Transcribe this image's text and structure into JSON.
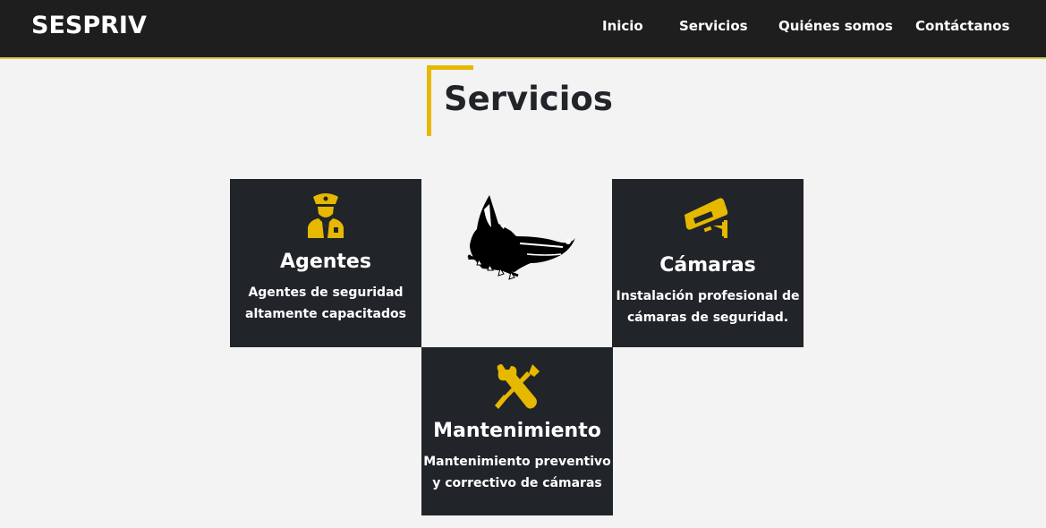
{
  "nav": {
    "brand": "SESPRIV",
    "links": [
      "Inicio",
      "Servicios",
      "Quiénes somos",
      "Contáctanos"
    ]
  },
  "section": {
    "title": "Servicios"
  },
  "services": [
    {
      "title": "Agentes",
      "description_line1": "Agentes de seguridad",
      "description_line2": "altamente capacitados",
      "icon": "security-guard-icon"
    },
    {
      "title": "Cámaras",
      "description_line1": "Instalación profesional de",
      "description_line2": "cámaras de seguridad.",
      "icon": "cctv-camera-icon"
    },
    {
      "title": "Mantenimiento",
      "description_line1": "Mantenimiento preventivo",
      "description_line2": "y correctivo de cámaras",
      "icon": "tools-icon"
    }
  ],
  "center_image": {
    "icon": "doberman-dog-icon"
  },
  "colors": {
    "dark": "#212529",
    "accent": "#e6b800",
    "background": "#f3f3f3",
    "navbar": "#1e1e1e"
  }
}
